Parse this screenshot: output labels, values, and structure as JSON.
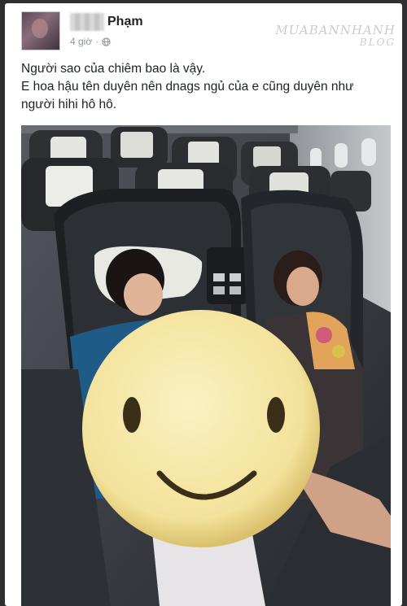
{
  "post": {
    "author_name": "Phạm",
    "timestamp": "4 giờ",
    "separator": "·",
    "privacy_icon": "globe-icon",
    "lines": [
      "Người sao của chiêm bao là vậy.",
      "E hoa hậu tên duyên nên dnags ngủ của e cũng duyên như",
      "người hihi hô hô."
    ],
    "photo_icon": "smiley-face-icon"
  },
  "watermark": {
    "brand": "MUABANNHANH",
    "sub": "BLOG"
  },
  "colors": {
    "card": "#ffffff",
    "background": "#2f2f31",
    "meta_text": "#9197a3",
    "emoji_fill": "#f6e7a6"
  }
}
